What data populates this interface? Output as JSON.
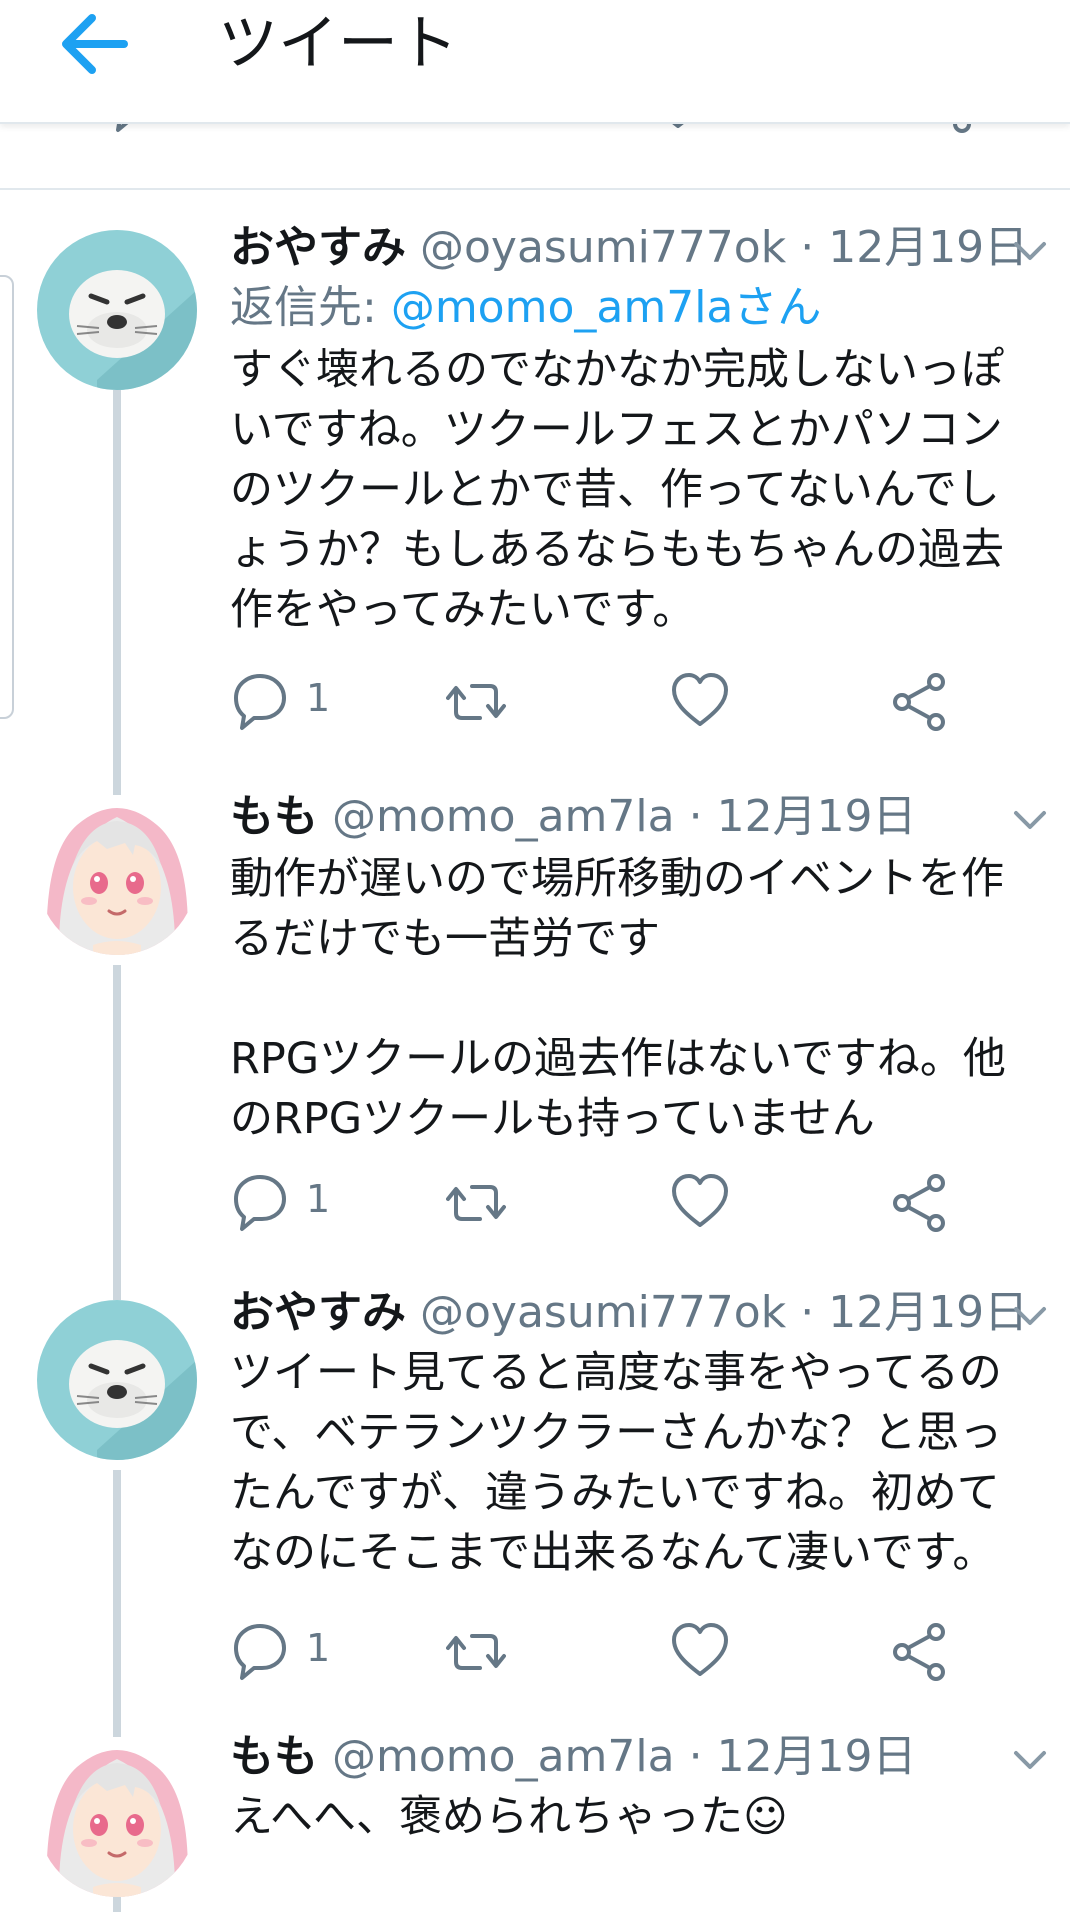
{
  "header": {
    "title": "ツイート",
    "back_icon": "arrow-left-icon",
    "accent": "#1da1f2"
  },
  "tweets": [
    {
      "name": "おやすみ",
      "handle": "@oyasumi777ok",
      "dot": "·",
      "date": "12月19日",
      "reply_prefix": "返信先: ",
      "reply_to": "@momo_am7laさん",
      "text": "すぐ壊れるのでなかなか完成しないっぽいですね。ツクールフェスとかパソコンのツクールとかで昔、作ってないんでしょうか？もしあるならももちゃんの過去作をやってみたいです。",
      "reply_count": "1",
      "avatar": "seal-avatar"
    },
    {
      "name": "もも",
      "handle": "@momo_am7la",
      "dot": "·",
      "date": "12月19日",
      "text": "動作が遅いので場所移動のイベントを作るだけでも一苦労です\n\nRPGツクールの過去作はないですね。他のRPGツクールも持っていません",
      "reply_count": "1",
      "avatar": "anime-girl-avatar"
    },
    {
      "name": "おやすみ",
      "handle": "@oyasumi777ok",
      "dot": "·",
      "date": "12月19日",
      "text": "ツイート見てると高度な事をやってるので、ベテランツクラーさんかな？と思ったんですが、違うみたいですね。初めてなのにそこまで出来るなんて凄いです。",
      "reply_count": "1",
      "avatar": "seal-avatar"
    },
    {
      "name": "もも",
      "handle": "@momo_am7la",
      "dot": "·",
      "date": "12月19日",
      "text": "えへへ、褒められちゃった☺",
      "avatar": "anime-girl-avatar"
    }
  ]
}
